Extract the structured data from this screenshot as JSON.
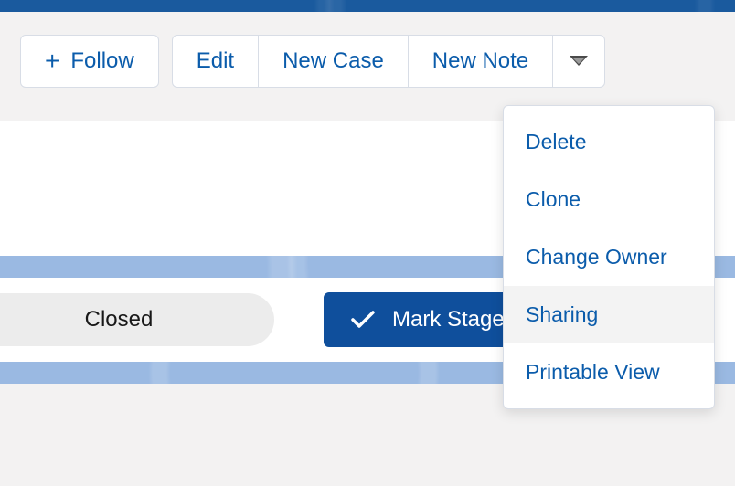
{
  "actions": {
    "follow": "Follow",
    "edit": "Edit",
    "new_case": "New Case",
    "new_note": "New Note"
  },
  "stage": {
    "closed_label": "Closed",
    "mark_stage_label": "Mark Stage as Complete"
  },
  "dropdown": {
    "items": [
      {
        "label": "Delete"
      },
      {
        "label": "Clone"
      },
      {
        "label": "Change Owner"
      },
      {
        "label": "Sharing"
      },
      {
        "label": "Printable View"
      }
    ],
    "highlighted_index": 3
  }
}
